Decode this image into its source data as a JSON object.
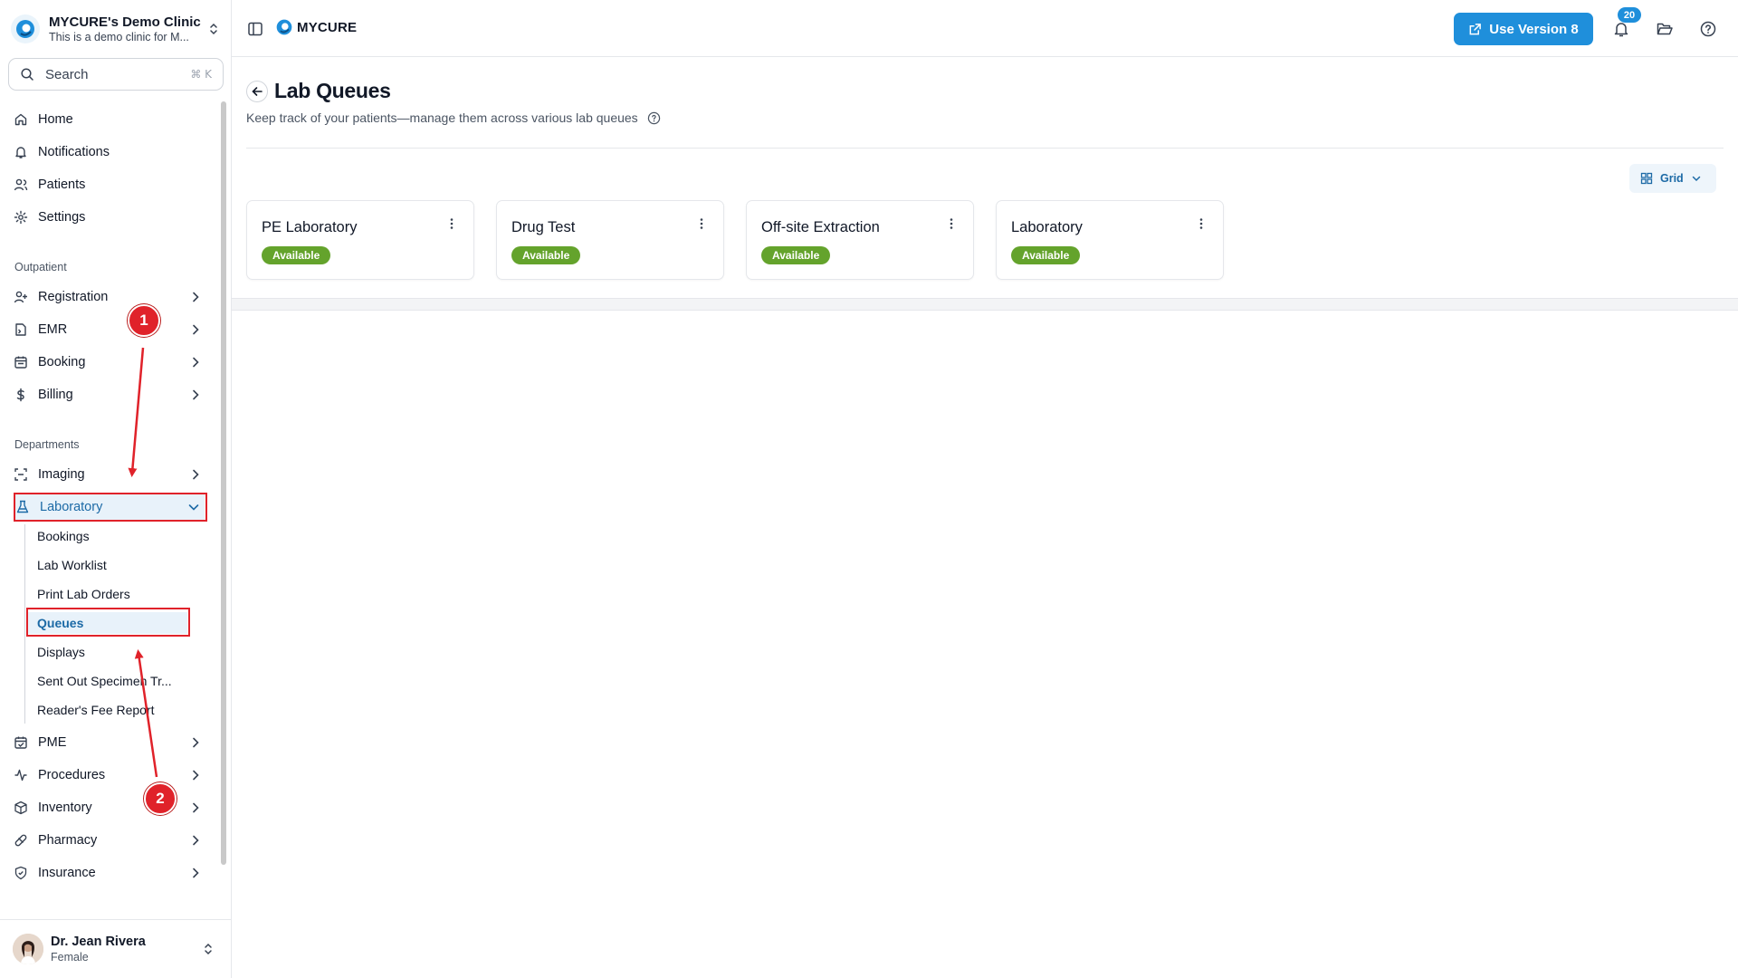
{
  "sidebar": {
    "clinic": {
      "name": "MYCURE's Demo Clinic",
      "description": "This is a demo clinic for M..."
    },
    "search": {
      "placeholder": "Search",
      "shortcut": "⌘ K"
    },
    "main_items": [
      {
        "label": "Home",
        "icon": "home-icon"
      },
      {
        "label": "Notifications",
        "icon": "bell-icon"
      },
      {
        "label": "Patients",
        "icon": "users-icon"
      },
      {
        "label": "Settings",
        "icon": "gear-icon"
      }
    ],
    "outpatient_label": "Outpatient",
    "outpatient_items": [
      {
        "label": "Registration",
        "icon": "user-plus-icon"
      },
      {
        "label": "EMR",
        "icon": "file-icon"
      },
      {
        "label": "Booking",
        "icon": "calendar-icon"
      },
      {
        "label": "Billing",
        "icon": "dollar-icon"
      }
    ],
    "departments_label": "Departments",
    "departments_items": [
      {
        "label": "Imaging",
        "icon": "scan-icon"
      },
      {
        "label": "Laboratory",
        "icon": "flask-icon",
        "expanded": true
      }
    ],
    "laboratory_sub_items": [
      {
        "label": "Bookings"
      },
      {
        "label": "Lab Worklist"
      },
      {
        "label": "Print Lab Orders"
      },
      {
        "label": "Queues",
        "active": true
      },
      {
        "label": "Displays"
      },
      {
        "label": "Sent Out Specimen Tr..."
      },
      {
        "label": "Reader's Fee Report"
      }
    ],
    "more_items": [
      {
        "label": "PME",
        "icon": "calendar-check-icon"
      },
      {
        "label": "Procedures",
        "icon": "activity-icon"
      },
      {
        "label": "Inventory",
        "icon": "box-icon"
      },
      {
        "label": "Pharmacy",
        "icon": "pill-icon"
      },
      {
        "label": "Insurance",
        "icon": "shield-icon"
      }
    ],
    "user": {
      "name": "Dr. Jean Rivera",
      "subtitle": "Female"
    }
  },
  "annotations": {
    "step1": "1",
    "step2": "2",
    "highlight_color": "#e0222a"
  },
  "header": {
    "brand": "MYCURE",
    "use_version_label": "Use Version 8",
    "notification_count": "20",
    "accent": "#1f8fdb"
  },
  "page": {
    "title": "Lab Queues",
    "subtitle": "Keep track of your patients—manage them across various lab queues",
    "view_mode": "Grid"
  },
  "queues": [
    {
      "name": "PE Laboratory",
      "status": "Available"
    },
    {
      "name": "Drug Test",
      "status": "Available"
    },
    {
      "name": "Off-site Extraction",
      "status": "Available"
    },
    {
      "name": "Laboratory",
      "status": "Available"
    }
  ],
  "colors": {
    "active_text": "#1c6aa6",
    "active_bg": "#e8f2fa",
    "available_badge": "#64a32c"
  }
}
